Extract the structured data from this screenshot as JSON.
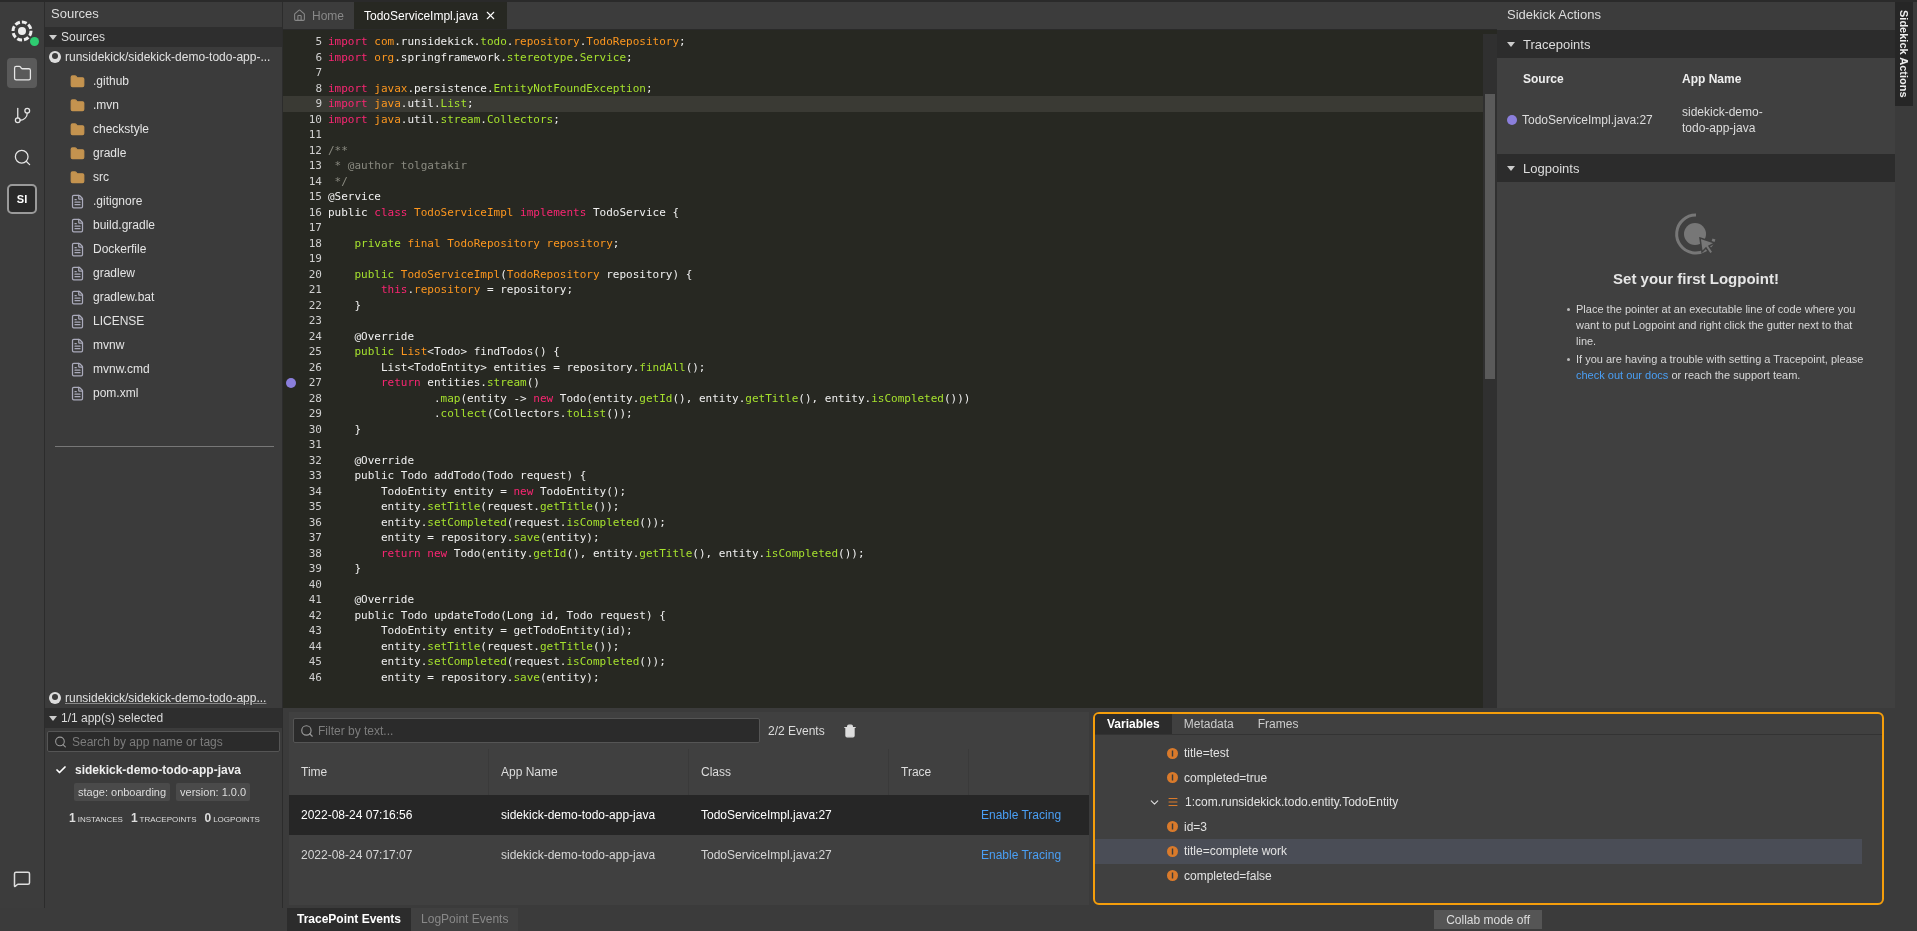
{
  "activity_bar": {
    "items": [
      {
        "selected": true
      },
      {
        "selected": false
      },
      {
        "selected": false
      }
    ],
    "badge_label": "SI",
    "online": true
  },
  "sidebar": {
    "title": "Sources",
    "section": {
      "label": "Sources",
      "expanded": true
    },
    "repo": "runsidekick/sidekick-demo-todo-app-...",
    "files": [
      {
        "kind": "folder",
        "name": ".github"
      },
      {
        "kind": "folder",
        "name": ".mvn"
      },
      {
        "kind": "folder",
        "name": "checkstyle"
      },
      {
        "kind": "folder",
        "name": "gradle"
      },
      {
        "kind": "folder",
        "name": "src"
      },
      {
        "kind": "file",
        "name": ".gitignore"
      },
      {
        "kind": "file",
        "name": "build.gradle"
      },
      {
        "kind": "file",
        "name": "Dockerfile"
      },
      {
        "kind": "file",
        "name": "gradlew"
      },
      {
        "kind": "file",
        "name": "gradlew.bat"
      },
      {
        "kind": "file",
        "name": "LICENSE"
      },
      {
        "kind": "file",
        "name": "mvnw"
      },
      {
        "kind": "file",
        "name": "mvnw.cmd"
      },
      {
        "kind": "file",
        "name": "pom.xml"
      }
    ],
    "apps_repo": "runsidekick/sidekick-demo-todo-app...",
    "apps_section": {
      "label": "1/1 app(s) selected",
      "expanded": true
    },
    "app_search": {
      "placeholder": "Search by app name or tags"
    },
    "apps": [
      {
        "name": "sidekick-demo-todo-app-java",
        "checked": true,
        "tags": [
          "stage: onboarding",
          "version: 1.0.0"
        ],
        "stats": [
          {
            "number": "1",
            "unit": "INSTANCES"
          },
          {
            "number": "1",
            "unit": "TRACEPOINTS"
          },
          {
            "number": "0",
            "unit": "LOGPOINTS"
          }
        ]
      }
    ]
  },
  "editor": {
    "tabs": [
      {
        "kind": "home",
        "label": "Home",
        "selected": false
      },
      {
        "kind": "file",
        "label": "TodoServiceImpl.java",
        "selected": true,
        "closable": true
      }
    ],
    "lines": [
      {
        "number": "5",
        "highlighted": false,
        "breakpoint": false,
        "tokens": [
          {
            "kind": "keyword",
            "text": "import "
          },
          {
            "kind": "type",
            "text": "com"
          },
          {
            "kind": "plain",
            "text": ".runsidekick."
          },
          {
            "kind": "method",
            "text": "todo"
          },
          {
            "kind": "plain",
            "text": "."
          },
          {
            "kind": "type",
            "text": "repository"
          },
          {
            "kind": "plain",
            "text": "."
          },
          {
            "kind": "type",
            "text": "TodoRepository"
          },
          {
            "kind": "plain",
            "text": ";"
          }
        ]
      },
      {
        "number": "6",
        "highlighted": false,
        "breakpoint": false,
        "tokens": [
          {
            "kind": "keyword",
            "text": "import "
          },
          {
            "kind": "type",
            "text": "org"
          },
          {
            "kind": "plain",
            "text": ".springframework."
          },
          {
            "kind": "method",
            "text": "stereotype"
          },
          {
            "kind": "plain",
            "text": "."
          },
          {
            "kind": "method",
            "text": "Service"
          },
          {
            "kind": "plain",
            "text": ";"
          }
        ]
      },
      {
        "number": "7",
        "highlighted": false,
        "breakpoint": false
      },
      {
        "number": "8",
        "highlighted": false,
        "breakpoint": false,
        "tokens": [
          {
            "kind": "keyword",
            "text": "import "
          },
          {
            "kind": "type",
            "text": "javax"
          },
          {
            "kind": "plain",
            "text": ".persistence."
          },
          {
            "kind": "method",
            "text": "EntityNotFoundException"
          },
          {
            "kind": "plain",
            "text": ";"
          }
        ]
      },
      {
        "number": "9",
        "highlighted": true,
        "breakpoint": false,
        "tokens": [
          {
            "kind": "keyword",
            "text": "import "
          },
          {
            "kind": "type",
            "text": "java"
          },
          {
            "kind": "plain",
            "text": ".util."
          },
          {
            "kind": "method",
            "text": "List"
          },
          {
            "kind": "plain",
            "text": ";"
          }
        ]
      },
      {
        "number": "10",
        "highlighted": false,
        "breakpoint": false,
        "tokens": [
          {
            "kind": "keyword",
            "text": "import "
          },
          {
            "kind": "type",
            "text": "java"
          },
          {
            "kind": "plain",
            "text": ".util."
          },
          {
            "kind": "method",
            "text": "stream"
          },
          {
            "kind": "plain",
            "text": "."
          },
          {
            "kind": "method",
            "text": "Collectors"
          },
          {
            "kind": "plain",
            "text": ";"
          }
        ]
      },
      {
        "number": "11",
        "highlighted": false,
        "breakpoint": false
      },
      {
        "number": "12",
        "highlighted": false,
        "breakpoint": false,
        "tokens": [
          {
            "kind": "comment",
            "text": "/**"
          }
        ]
      },
      {
        "number": "13",
        "highlighted": false,
        "breakpoint": false,
        "tokens": [
          {
            "kind": "comment",
            "text": " * @author tolgatakir"
          }
        ]
      },
      {
        "number": "14",
        "highlighted": false,
        "breakpoint": false,
        "tokens": [
          {
            "kind": "comment",
            "text": " */"
          }
        ]
      },
      {
        "number": "15",
        "highlighted": false,
        "breakpoint": false,
        "tokens": [
          {
            "kind": "plain",
            "text": "@Service"
          }
        ]
      },
      {
        "number": "16",
        "highlighted": false,
        "breakpoint": false,
        "tokens": [
          {
            "kind": "plain",
            "text": "public "
          },
          {
            "kind": "keyword",
            "text": "class "
          },
          {
            "kind": "type",
            "text": "TodoServiceImpl "
          },
          {
            "kind": "keyword",
            "text": "implements "
          },
          {
            "kind": "plain",
            "text": "TodoService {"
          }
        ]
      },
      {
        "number": "17",
        "highlighted": false,
        "breakpoint": false
      },
      {
        "number": "18",
        "highlighted": false,
        "breakpoint": false,
        "tokens": [
          {
            "kind": "method",
            "text": "    private "
          },
          {
            "kind": "type",
            "text": "final TodoRepository repository"
          },
          {
            "kind": "plain",
            "text": ";"
          }
        ]
      },
      {
        "number": "19",
        "highlighted": false,
        "breakpoint": false
      },
      {
        "number": "20",
        "highlighted": false,
        "breakpoint": false,
        "tokens": [
          {
            "kind": "method",
            "text": "    public "
          },
          {
            "kind": "type",
            "text": "TodoServiceImpl"
          },
          {
            "kind": "plain",
            "text": "("
          },
          {
            "kind": "type",
            "text": "TodoRepository "
          },
          {
            "kind": "plain",
            "text": "repository) {"
          }
        ]
      },
      {
        "number": "21",
        "highlighted": false,
        "breakpoint": false,
        "tokens": [
          {
            "kind": "keyword",
            "text": "        this"
          },
          {
            "kind": "plain",
            "text": "."
          },
          {
            "kind": "type",
            "text": "repository"
          },
          {
            "kind": "plain",
            "text": " = repository;"
          }
        ]
      },
      {
        "number": "22",
        "highlighted": false,
        "breakpoint": false,
        "tokens": [
          {
            "kind": "plain",
            "text": "    }"
          }
        ]
      },
      {
        "number": "23",
        "highlighted": false,
        "breakpoint": false
      },
      {
        "number": "24",
        "highlighted": false,
        "breakpoint": false,
        "tokens": [
          {
            "kind": "plain",
            "text": "    @Override"
          }
        ]
      },
      {
        "number": "25",
        "highlighted": false,
        "breakpoint": false,
        "tokens": [
          {
            "kind": "method",
            "text": "    public "
          },
          {
            "kind": "type",
            "text": "List"
          },
          {
            "kind": "plain",
            "text": "<Todo> findTodos() {"
          }
        ]
      },
      {
        "number": "26",
        "highlighted": false,
        "breakpoint": false,
        "tokens": [
          {
            "kind": "plain",
            "text": "        List<TodoEntity> entities = repository."
          },
          {
            "kind": "method",
            "text": "findAll"
          },
          {
            "kind": "plain",
            "text": "();"
          }
        ]
      },
      {
        "number": "27",
        "highlighted": false,
        "breakpoint": true,
        "tokens": [
          {
            "kind": "keyword",
            "text": "        return "
          },
          {
            "kind": "plain",
            "text": "entities."
          },
          {
            "kind": "method",
            "text": "stream"
          },
          {
            "kind": "plain",
            "text": "()"
          }
        ]
      },
      {
        "number": "28",
        "highlighted": false,
        "breakpoint": false,
        "tokens": [
          {
            "kind": "plain",
            "text": "                ."
          },
          {
            "kind": "method",
            "text": "map"
          },
          {
            "kind": "plain",
            "text": "(entity -> "
          },
          {
            "kind": "keyword",
            "text": "new "
          },
          {
            "kind": "plain",
            "text": "Todo(entity."
          },
          {
            "kind": "method",
            "text": "getId"
          },
          {
            "kind": "plain",
            "text": "(), entity."
          },
          {
            "kind": "method",
            "text": "getTitle"
          },
          {
            "kind": "plain",
            "text": "(), entity."
          },
          {
            "kind": "method",
            "text": "isCompleted"
          },
          {
            "kind": "plain",
            "text": "()))"
          }
        ]
      },
      {
        "number": "29",
        "highlighted": false,
        "breakpoint": false,
        "tokens": [
          {
            "kind": "plain",
            "text": "                ."
          },
          {
            "kind": "method",
            "text": "collect"
          },
          {
            "kind": "plain",
            "text": "(Collectors."
          },
          {
            "kind": "method",
            "text": "toList"
          },
          {
            "kind": "plain",
            "text": "());"
          }
        ]
      },
      {
        "number": "30",
        "highlighted": false,
        "breakpoint": false,
        "tokens": [
          {
            "kind": "plain",
            "text": "    }"
          }
        ]
      },
      {
        "number": "31",
        "highlighted": false,
        "breakpoint": false
      },
      {
        "number": "32",
        "highlighted": false,
        "breakpoint": false,
        "tokens": [
          {
            "kind": "plain",
            "text": "    @Override"
          }
        ]
      },
      {
        "number": "33",
        "highlighted": false,
        "breakpoint": false,
        "tokens": [
          {
            "kind": "plain",
            "text": "    public Todo addTodo(Todo request) {"
          }
        ]
      },
      {
        "number": "34",
        "highlighted": false,
        "breakpoint": false,
        "tokens": [
          {
            "kind": "plain",
            "text": "        TodoEntity entity = "
          },
          {
            "kind": "keyword",
            "text": "new "
          },
          {
            "kind": "plain",
            "text": "TodoEntity();"
          }
        ]
      },
      {
        "number": "35",
        "highlighted": false,
        "breakpoint": false,
        "tokens": [
          {
            "kind": "plain",
            "text": "        entity."
          },
          {
            "kind": "method",
            "text": "setTitle"
          },
          {
            "kind": "plain",
            "text": "(request."
          },
          {
            "kind": "method",
            "text": "getTitle"
          },
          {
            "kind": "plain",
            "text": "());"
          }
        ]
      },
      {
        "number": "36",
        "highlighted": false,
        "breakpoint": false,
        "tokens": [
          {
            "kind": "plain",
            "text": "        entity."
          },
          {
            "kind": "method",
            "text": "setCompleted"
          },
          {
            "kind": "plain",
            "text": "(request."
          },
          {
            "kind": "method",
            "text": "isCompleted"
          },
          {
            "kind": "plain",
            "text": "());"
          }
        ]
      },
      {
        "number": "37",
        "highlighted": false,
        "breakpoint": false,
        "tokens": [
          {
            "kind": "plain",
            "text": "        entity = repository."
          },
          {
            "kind": "method",
            "text": "save"
          },
          {
            "kind": "plain",
            "text": "(entity);"
          }
        ]
      },
      {
        "number": "38",
        "highlighted": false,
        "breakpoint": false,
        "tokens": [
          {
            "kind": "keyword",
            "text": "        return new "
          },
          {
            "kind": "plain",
            "text": "Todo(entity."
          },
          {
            "kind": "method",
            "text": "getId"
          },
          {
            "kind": "plain",
            "text": "(), entity."
          },
          {
            "kind": "method",
            "text": "getTitle"
          },
          {
            "kind": "plain",
            "text": "(), entity."
          },
          {
            "kind": "method",
            "text": "isCompleted"
          },
          {
            "kind": "plain",
            "text": "());"
          }
        ]
      },
      {
        "number": "39",
        "highlighted": false,
        "breakpoint": false,
        "tokens": [
          {
            "kind": "plain",
            "text": "    }"
          }
        ]
      },
      {
        "number": "40",
        "highlighted": false,
        "breakpoint": false
      },
      {
        "number": "41",
        "highlighted": false,
        "breakpoint": false,
        "tokens": [
          {
            "kind": "plain",
            "text": "    @Override"
          }
        ]
      },
      {
        "number": "42",
        "highlighted": false,
        "breakpoint": false,
        "tokens": [
          {
            "kind": "plain",
            "text": "    public Todo updateTodo(Long id, Todo request) {"
          }
        ]
      },
      {
        "number": "43",
        "highlighted": false,
        "breakpoint": false,
        "tokens": [
          {
            "kind": "plain",
            "text": "        TodoEntity entity = getTodoEntity(id);"
          }
        ]
      },
      {
        "number": "44",
        "highlighted": false,
        "breakpoint": false,
        "tokens": [
          {
            "kind": "plain",
            "text": "        entity."
          },
          {
            "kind": "method",
            "text": "setTitle"
          },
          {
            "kind": "plain",
            "text": "(request."
          },
          {
            "kind": "method",
            "text": "getTitle"
          },
          {
            "kind": "plain",
            "text": "());"
          }
        ]
      },
      {
        "number": "45",
        "highlighted": false,
        "breakpoint": false,
        "tokens": [
          {
            "kind": "plain",
            "text": "        entity."
          },
          {
            "kind": "method",
            "text": "setCompleted"
          },
          {
            "kind": "plain",
            "text": "(request."
          },
          {
            "kind": "method",
            "text": "isCompleted"
          },
          {
            "kind": "plain",
            "text": "());"
          }
        ]
      },
      {
        "number": "46",
        "highlighted": false,
        "breakpoint": false,
        "tokens": [
          {
            "kind": "plain",
            "text": "        entity = repository."
          },
          {
            "kind": "method",
            "text": "save"
          },
          {
            "kind": "plain",
            "text": "(entity);"
          }
        ]
      }
    ]
  },
  "actions": {
    "title": "Sidekick Actions",
    "side_tab": "Sidekick Actions",
    "tracepoints": {
      "label": "Tracepoints",
      "expanded": true,
      "columns": [
        "Source",
        "App Name"
      ],
      "rows": [
        {
          "source": "TodoServiceImpl.java:27",
          "app": "sidekick-demo-todo-app-java",
          "color": "#8b7fdc"
        }
      ]
    },
    "logpoints": {
      "label": "Logpoints",
      "expanded": true,
      "empty_title": "Set your first Logpoint!",
      "bullets": [
        {
          "text": "Place the pointer at an executable line of code where you want to put Logpoint and right click the gutter next to that line."
        },
        {
          "text": "If you are having a trouble with setting a Tracepoint, please ",
          "link": "check out our docs",
          "after": " or reach the support team."
        }
      ]
    }
  },
  "events": {
    "filter": {
      "placeholder": "Filter by text..."
    },
    "count": "2/2 Events",
    "columns": [
      "Time",
      "App Name",
      "Class",
      "Trace"
    ],
    "rows": [
      {
        "time": "2022-08-24 07:16:56",
        "app": "sidekick-demo-todo-app-java",
        "class": "TodoServiceImpl.java:27",
        "action": "Enable Tracing",
        "selected": true
      },
      {
        "time": "2022-08-24 07:17:07",
        "app": "sidekick-demo-todo-app-java",
        "class": "TodoServiceImpl.java:27",
        "action": "Enable Tracing",
        "selected": false
      }
    ],
    "tabs": [
      {
        "label": "TracePoint Events",
        "selected": true
      },
      {
        "label": "LogPoint Events",
        "selected": false
      }
    ]
  },
  "details": {
    "focused": true,
    "tabs": [
      {
        "label": "Variables",
        "selected": true
      },
      {
        "label": "Metadata",
        "selected": false
      },
      {
        "label": "Frames",
        "selected": false
      }
    ],
    "variables": [
      {
        "kind": "field",
        "label": "title=test",
        "selected": false
      },
      {
        "kind": "field",
        "label": "completed=true",
        "selected": false
      },
      {
        "kind": "object",
        "label": "1:com.runsidekick.todo.entity.TodoEntity",
        "expanded": true,
        "selected": false,
        "children": [
          {
            "kind": "field",
            "label": "id=3",
            "selected": false
          },
          {
            "kind": "field",
            "label": "title=complete work",
            "selected": true
          },
          {
            "kind": "field",
            "label": "completed=false",
            "selected": false
          }
        ]
      }
    ]
  },
  "status_bar": {
    "collab_button": "Collab mode off"
  }
}
